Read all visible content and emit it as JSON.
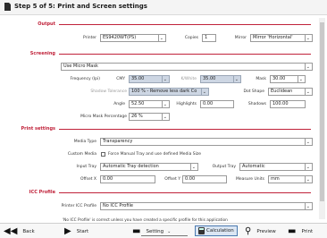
{
  "header": {
    "title": "Step 5 of 5: Print and Screen settings"
  },
  "output": {
    "section_label": "Output",
    "printer_label": "Printer",
    "printer_value": "ES9420WT(PS)",
    "copies_label": "Copies",
    "copies_value": "1",
    "mirror_label": "Mirror",
    "mirror_value": "Mirror 'Horizontal'"
  },
  "screening": {
    "section_label": "Screening",
    "mask_select": "Use Micro Mask",
    "frequency_label": "Frequency (lpi)",
    "cmy_label": "CMY",
    "cmy_value": "35.00",
    "kwhite_label": "K/White",
    "kwhite_value": "35.00",
    "mask_label": "Mask",
    "mask_value": "30.00",
    "shadow_tol_label": "Shadow Tolerance",
    "shadow_tol_value": "100 % - Remove less dark Co",
    "dot_shape_label": "Dot Shape",
    "dot_shape_value": "Euclidean",
    "angle_label": "Angle",
    "angle_value": "52.50",
    "highlights_label": "Highlights",
    "highlights_value": "0.00",
    "shadows_label": "Shadows",
    "shadows_value": "100.00",
    "micro_mask_pct_label": "Micro Mask Percentage",
    "micro_mask_pct_value": "26 %"
  },
  "print_settings": {
    "section_label": "Print settings",
    "media_type_label": "Media Type",
    "media_type_value": "Transparency",
    "custom_media_label": "Custom Media",
    "force_manual_label": "Force Manual Tray and use defined Media Size",
    "input_tray_label": "Input Tray",
    "input_tray_value": "Automatic Tray detection",
    "output_tray_label": "Output Tray",
    "output_tray_value": "Automatic",
    "offset_x_label": "Offset X",
    "offset_x_value": "0.00",
    "offset_y_label": "Offset Y",
    "offset_y_value": "0.00",
    "measure_units_label": "Measure Units",
    "measure_units_value": "mm"
  },
  "icc_profile": {
    "section_label": "ICC Profile",
    "printer_icc_label": "Printer ICC Profile",
    "printer_icc_value": "No ICC Profile",
    "note": "'No ICC Profile' is correct unless you have created a specific profile for this application"
  },
  "toolbar": {
    "back": "Back",
    "start": "Start",
    "setting": "Setting",
    "calculation": "Calculation",
    "preview": "Preview",
    "print": "Print"
  }
}
